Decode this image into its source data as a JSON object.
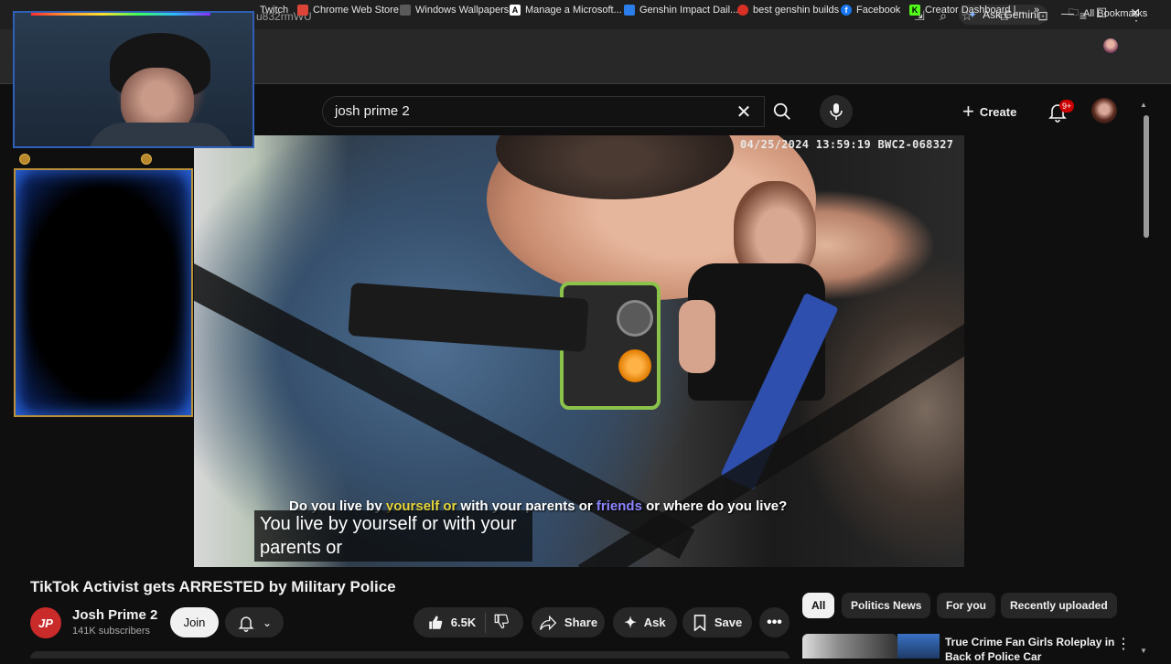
{
  "browser": {
    "url_fragment": "u832rmWU",
    "ask_gemini": "Ask Gemini",
    "window_controls": [
      "minimize-icon",
      "maximize-icon",
      "close-icon"
    ],
    "bookmarks": [
      {
        "label": "Twitch",
        "icon": "twitch-icon",
        "color": "#9146ff"
      },
      {
        "label": "Chrome Web Store",
        "icon": "chrome-web-store-icon",
        "color": "#db4437"
      },
      {
        "label": "Windows Wallpapers",
        "icon": "wallpaper-icon",
        "color": "#5a5a5a"
      },
      {
        "label": "Manage a Microsoft...",
        "icon": "microsoft-icon",
        "color": "#ffffff"
      },
      {
        "label": "Genshin Impact Dail...",
        "icon": "genshin-icon",
        "color": "#2b7de9"
      },
      {
        "label": "best genshin builds",
        "icon": "builds-icon",
        "color": "#d93025"
      },
      {
        "label": "Facebook",
        "icon": "facebook-icon",
        "color": "#1877f2"
      },
      {
        "label": "Creator Dashboard |...",
        "icon": "kick-icon",
        "color": "#53fc18"
      }
    ],
    "all_bookmarks": "All Bookmarks"
  },
  "youtube": {
    "search_value": "josh prime 2",
    "create_label": "Create",
    "notification_count": "9+"
  },
  "video": {
    "timestamp": "04/25/2024 13:59:19  BWC2-068327",
    "burned_caption": {
      "part1": "Do you live by ",
      "part2_yellow": "yourself or",
      "part3": " with your parents or ",
      "part4_purple": "friends",
      "part5": " or where do you live?"
    },
    "closed_caption_line1": "You live by yourself or with your",
    "closed_caption_line2": "parents or",
    "title": "TikTok Activist gets ARRESTED by Military Police"
  },
  "channel": {
    "logo_text": "JP",
    "name": "Josh Prime 2",
    "subscribers": "141K subscribers",
    "join_label": "Join"
  },
  "actions": {
    "like_count": "6.5K",
    "share_label": "Share",
    "ask_label": "Ask",
    "save_label": "Save"
  },
  "chips": [
    "All",
    "Politics News",
    "For you",
    "Recently uploaded"
  ],
  "recommendation": {
    "title": "True Crime Fan Girls Roleplay in Back of Police Car"
  },
  "colors": {
    "accent_red": "#cc0000",
    "webcam_border": "#2f5fb7",
    "frame_gold": "#b8903a"
  }
}
